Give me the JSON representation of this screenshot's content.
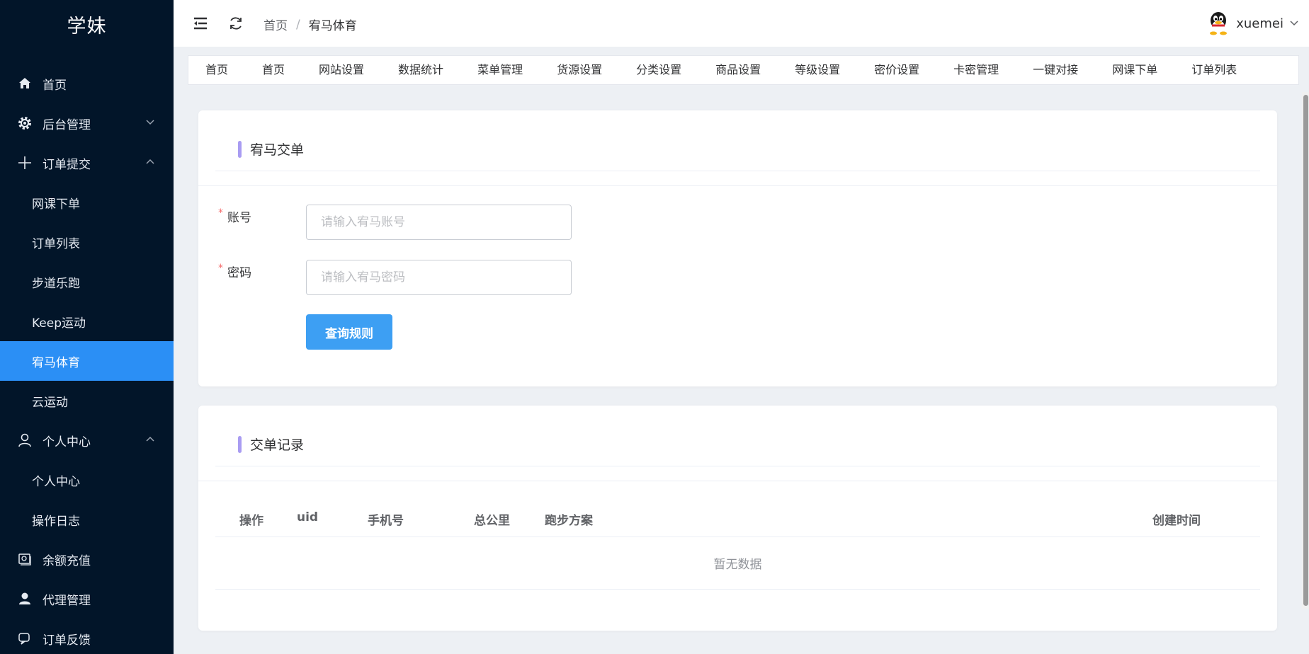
{
  "brand": {
    "name": "学妹"
  },
  "sidebar": {
    "items": [
      {
        "label": "首页",
        "icon": "home-icon"
      },
      {
        "label": "后台管理",
        "icon": "gear-icon",
        "expanded": false
      },
      {
        "label": "订单提交",
        "icon": "plus-icon",
        "expanded": true,
        "children": [
          "网课下单",
          "订单列表",
          "步道乐跑",
          "Keep运动",
          "宥马体育",
          "云运动"
        ]
      },
      {
        "label": "个人中心",
        "icon": "user-icon",
        "expanded": true,
        "children": [
          "个人中心",
          "操作日志"
        ]
      },
      {
        "label": "余额充值",
        "icon": "wallet-icon"
      },
      {
        "label": "代理管理",
        "icon": "person-icon"
      },
      {
        "label": "订单反馈",
        "icon": "feedback-icon"
      }
    ],
    "active": "宥马体育",
    "active_color": "#2b8ff5"
  },
  "header": {
    "breadcrumb": [
      "首页",
      "宥马体育"
    ],
    "breadcrumb_sep": "/",
    "username": "xuemei"
  },
  "tabs": [
    "首页",
    "首页",
    "网站设置",
    "数据统计",
    "菜单管理",
    "货源设置",
    "分类设置",
    "商品设置",
    "等级设置",
    "密价设置",
    "卡密管理",
    "一键对接",
    "网课下单",
    "订单列表"
  ],
  "order_card": {
    "title": "宥马交单",
    "fields": [
      {
        "label": "账号",
        "placeholder": "请输入宥马账号",
        "value": "",
        "required": true
      },
      {
        "label": "密码",
        "placeholder": "请输入宥马密码",
        "value": "",
        "required": true
      }
    ],
    "submit_label": "查询规则",
    "required_mark": "*"
  },
  "records_card": {
    "title": "交单记录",
    "columns": [
      "操作",
      "uid",
      "手机号",
      "总公里",
      "跑步方案",
      "创建时间"
    ],
    "rows": [],
    "empty_text": "暂无数据"
  },
  "colors": {
    "accent_bar": "#a99cf2",
    "primary_button": "#3d9ff3",
    "sidebar_bg": "#021529"
  }
}
